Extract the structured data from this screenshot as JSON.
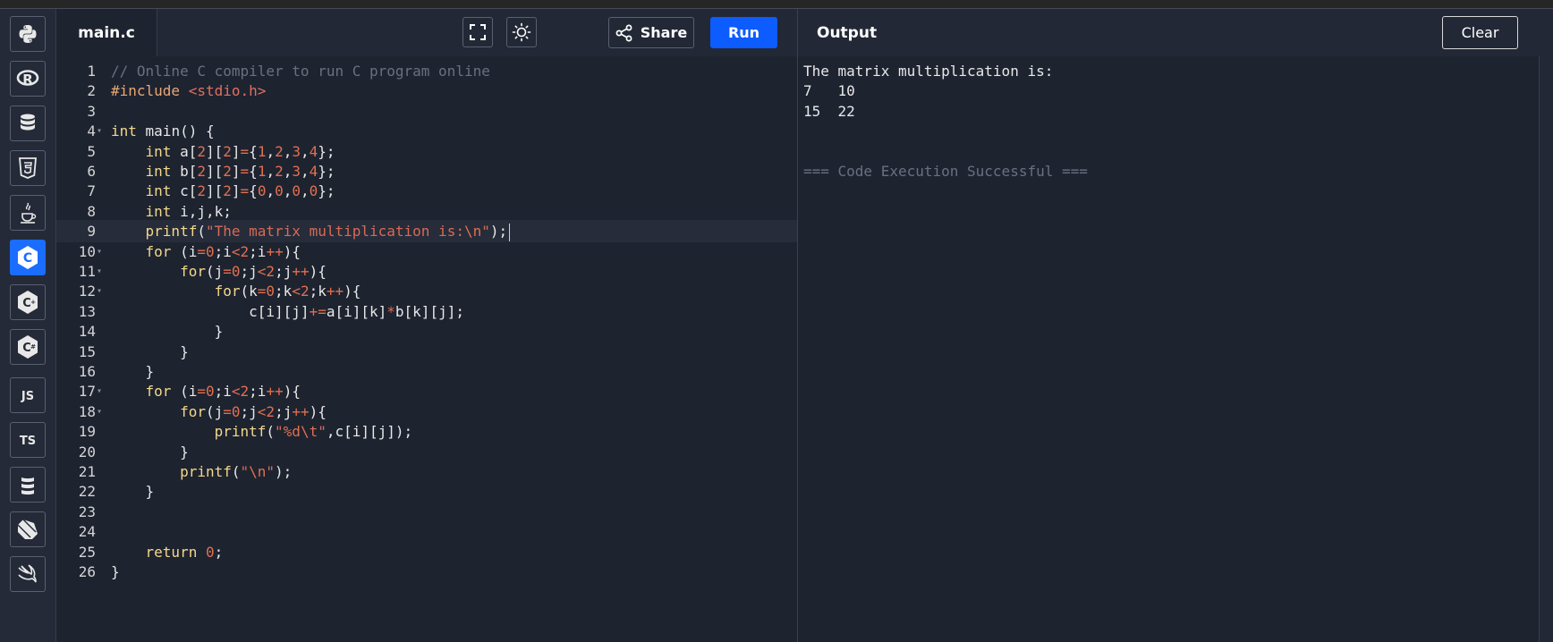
{
  "sidebar": {
    "items": [
      {
        "name": "python",
        "icon": "python-icon"
      },
      {
        "name": "r",
        "icon": "r-icon",
        "glyph": "R"
      },
      {
        "name": "sql",
        "icon": "database-icon"
      },
      {
        "name": "html",
        "icon": "html5-icon",
        "glyph": "5"
      },
      {
        "name": "java",
        "icon": "java-icon"
      },
      {
        "name": "c",
        "icon": "c-icon",
        "glyph": "C",
        "active": true
      },
      {
        "name": "cpp",
        "icon": "cpp-icon",
        "glyph": "C+"
      },
      {
        "name": "csharp",
        "icon": "csharp-icon",
        "glyph": "C#"
      },
      {
        "name": "javascript",
        "icon": "js-icon",
        "glyph": "JS"
      },
      {
        "name": "typescript",
        "icon": "ts-icon",
        "glyph": "TS"
      },
      {
        "name": "scala",
        "icon": "scala-icon"
      },
      {
        "name": "dart",
        "icon": "dart-icon"
      },
      {
        "name": "swift",
        "icon": "swift-icon"
      }
    ],
    "accent": "#1a6dff"
  },
  "editor": {
    "file_tab": "main.c",
    "share_label": "Share",
    "run_label": "Run",
    "run_color": "#0c5cff",
    "current_line": 9,
    "lines": [
      {
        "n": "1",
        "fold": false,
        "tokens": [
          [
            "com",
            "// Online C compiler to run C program online"
          ]
        ]
      },
      {
        "n": "2",
        "fold": false,
        "tokens": [
          [
            "pre",
            "#include "
          ],
          [
            "inc",
            "<stdio.h>"
          ]
        ]
      },
      {
        "n": "3",
        "fold": false,
        "tokens": []
      },
      {
        "n": "4",
        "fold": true,
        "tokens": [
          [
            "kw",
            "int"
          ],
          [
            "plain",
            " main() {"
          ]
        ]
      },
      {
        "n": "5",
        "fold": false,
        "tokens": [
          [
            "plain",
            "    "
          ],
          [
            "kw",
            "int"
          ],
          [
            "plain",
            " a["
          ],
          [
            "num",
            "2"
          ],
          [
            "plain",
            "]["
          ],
          [
            "num",
            "2"
          ],
          [
            "plain",
            "]"
          ],
          [
            "op",
            "="
          ],
          [
            "plain",
            "{"
          ],
          [
            "num",
            "1"
          ],
          [
            "plain",
            ","
          ],
          [
            "num",
            "2"
          ],
          [
            "plain",
            ","
          ],
          [
            "num",
            "3"
          ],
          [
            "plain",
            ","
          ],
          [
            "num",
            "4"
          ],
          [
            "plain",
            "};"
          ]
        ]
      },
      {
        "n": "6",
        "fold": false,
        "tokens": [
          [
            "plain",
            "    "
          ],
          [
            "kw",
            "int"
          ],
          [
            "plain",
            " b["
          ],
          [
            "num",
            "2"
          ],
          [
            "plain",
            "]["
          ],
          [
            "num",
            "2"
          ],
          [
            "plain",
            "]"
          ],
          [
            "op",
            "="
          ],
          [
            "plain",
            "{"
          ],
          [
            "num",
            "1"
          ],
          [
            "plain",
            ","
          ],
          [
            "num",
            "2"
          ],
          [
            "plain",
            ","
          ],
          [
            "num",
            "3"
          ],
          [
            "plain",
            ","
          ],
          [
            "num",
            "4"
          ],
          [
            "plain",
            "};"
          ]
        ]
      },
      {
        "n": "7",
        "fold": false,
        "tokens": [
          [
            "plain",
            "    "
          ],
          [
            "kw",
            "int"
          ],
          [
            "plain",
            " c["
          ],
          [
            "num",
            "2"
          ],
          [
            "plain",
            "]["
          ],
          [
            "num",
            "2"
          ],
          [
            "plain",
            "]"
          ],
          [
            "op",
            "="
          ],
          [
            "plain",
            "{"
          ],
          [
            "num",
            "0"
          ],
          [
            "plain",
            ","
          ],
          [
            "num",
            "0"
          ],
          [
            "plain",
            ","
          ],
          [
            "num",
            "0"
          ],
          [
            "plain",
            ","
          ],
          [
            "num",
            "0"
          ],
          [
            "plain",
            "};"
          ]
        ]
      },
      {
        "n": "8",
        "fold": false,
        "tokens": [
          [
            "plain",
            "    "
          ],
          [
            "kw",
            "int"
          ],
          [
            "plain",
            " i,j,k;"
          ]
        ]
      },
      {
        "n": "9",
        "fold": false,
        "tokens": [
          [
            "plain",
            "    "
          ],
          [
            "fn",
            "printf"
          ],
          [
            "plain",
            "("
          ],
          [
            "str",
            "\"The matrix multiplication is:"
          ],
          [
            "esc",
            "\\n"
          ],
          [
            "str",
            "\""
          ],
          [
            "plain",
            ");"
          ]
        ]
      },
      {
        "n": "10",
        "fold": true,
        "tokens": [
          [
            "plain",
            "    "
          ],
          [
            "kw",
            "for"
          ],
          [
            "plain",
            " (i"
          ],
          [
            "op",
            "="
          ],
          [
            "num",
            "0"
          ],
          [
            "plain",
            ";i"
          ],
          [
            "op",
            "<"
          ],
          [
            "num",
            "2"
          ],
          [
            "plain",
            ";i"
          ],
          [
            "op",
            "++"
          ],
          [
            "plain",
            "){"
          ]
        ]
      },
      {
        "n": "11",
        "fold": true,
        "tokens": [
          [
            "plain",
            "        "
          ],
          [
            "kw",
            "for"
          ],
          [
            "plain",
            "(j"
          ],
          [
            "op",
            "="
          ],
          [
            "num",
            "0"
          ],
          [
            "plain",
            ";j"
          ],
          [
            "op",
            "<"
          ],
          [
            "num",
            "2"
          ],
          [
            "plain",
            ";j"
          ],
          [
            "op",
            "++"
          ],
          [
            "plain",
            "){"
          ]
        ]
      },
      {
        "n": "12",
        "fold": true,
        "tokens": [
          [
            "plain",
            "            "
          ],
          [
            "kw",
            "for"
          ],
          [
            "plain",
            "(k"
          ],
          [
            "op",
            "="
          ],
          [
            "num",
            "0"
          ],
          [
            "plain",
            ";k"
          ],
          [
            "op",
            "<"
          ],
          [
            "num",
            "2"
          ],
          [
            "plain",
            ";k"
          ],
          [
            "op",
            "++"
          ],
          [
            "plain",
            "){"
          ]
        ]
      },
      {
        "n": "13",
        "fold": false,
        "tokens": [
          [
            "plain",
            "                c[i][j]"
          ],
          [
            "op",
            "+="
          ],
          [
            "plain",
            "a[i][k]"
          ],
          [
            "op",
            "*"
          ],
          [
            "plain",
            "b[k][j];"
          ]
        ]
      },
      {
        "n": "14",
        "fold": false,
        "tokens": [
          [
            "plain",
            "            }"
          ]
        ]
      },
      {
        "n": "15",
        "fold": false,
        "tokens": [
          [
            "plain",
            "        }"
          ]
        ]
      },
      {
        "n": "16",
        "fold": false,
        "tokens": [
          [
            "plain",
            "    }"
          ]
        ]
      },
      {
        "n": "17",
        "fold": true,
        "tokens": [
          [
            "plain",
            "    "
          ],
          [
            "kw",
            "for"
          ],
          [
            "plain",
            " (i"
          ],
          [
            "op",
            "="
          ],
          [
            "num",
            "0"
          ],
          [
            "plain",
            ";i"
          ],
          [
            "op",
            "<"
          ],
          [
            "num",
            "2"
          ],
          [
            "plain",
            ";i"
          ],
          [
            "op",
            "++"
          ],
          [
            "plain",
            "){"
          ]
        ]
      },
      {
        "n": "18",
        "fold": true,
        "tokens": [
          [
            "plain",
            "        "
          ],
          [
            "kw",
            "for"
          ],
          [
            "plain",
            "(j"
          ],
          [
            "op",
            "="
          ],
          [
            "num",
            "0"
          ],
          [
            "plain",
            ";j"
          ],
          [
            "op",
            "<"
          ],
          [
            "num",
            "2"
          ],
          [
            "plain",
            ";j"
          ],
          [
            "op",
            "++"
          ],
          [
            "plain",
            "){"
          ]
        ]
      },
      {
        "n": "19",
        "fold": false,
        "tokens": [
          [
            "plain",
            "            "
          ],
          [
            "fn",
            "printf"
          ],
          [
            "plain",
            "("
          ],
          [
            "str",
            "\""
          ],
          [
            "esc",
            "%d\\t"
          ],
          [
            "str",
            "\""
          ],
          [
            "plain",
            ",c[i][j]);"
          ]
        ]
      },
      {
        "n": "20",
        "fold": false,
        "tokens": [
          [
            "plain",
            "        }"
          ]
        ]
      },
      {
        "n": "21",
        "fold": false,
        "tokens": [
          [
            "plain",
            "        "
          ],
          [
            "fn",
            "printf"
          ],
          [
            "plain",
            "("
          ],
          [
            "str",
            "\""
          ],
          [
            "esc",
            "\\n"
          ],
          [
            "str",
            "\""
          ],
          [
            "plain",
            ");"
          ]
        ]
      },
      {
        "n": "22",
        "fold": false,
        "tokens": [
          [
            "plain",
            "    }"
          ]
        ]
      },
      {
        "n": "23",
        "fold": false,
        "tokens": []
      },
      {
        "n": "24",
        "fold": false,
        "tokens": []
      },
      {
        "n": "25",
        "fold": false,
        "tokens": [
          [
            "plain",
            "    "
          ],
          [
            "kw",
            "return"
          ],
          [
            "plain",
            " "
          ],
          [
            "num",
            "0"
          ],
          [
            "plain",
            ";"
          ]
        ]
      },
      {
        "n": "26",
        "fold": false,
        "tokens": [
          [
            "plain",
            "}"
          ]
        ]
      }
    ]
  },
  "output": {
    "title": "Output",
    "clear_label": "Clear",
    "lines": [
      {
        "text": "The matrix multiplication is:",
        "dim": false
      },
      {
        "text": "7   10",
        "dim": false
      },
      {
        "text": "15  22",
        "dim": false
      },
      {
        "text": "",
        "dim": false
      },
      {
        "text": "",
        "dim": false
      },
      {
        "text": "=== Code Execution Successful ===",
        "dim": true
      }
    ]
  }
}
